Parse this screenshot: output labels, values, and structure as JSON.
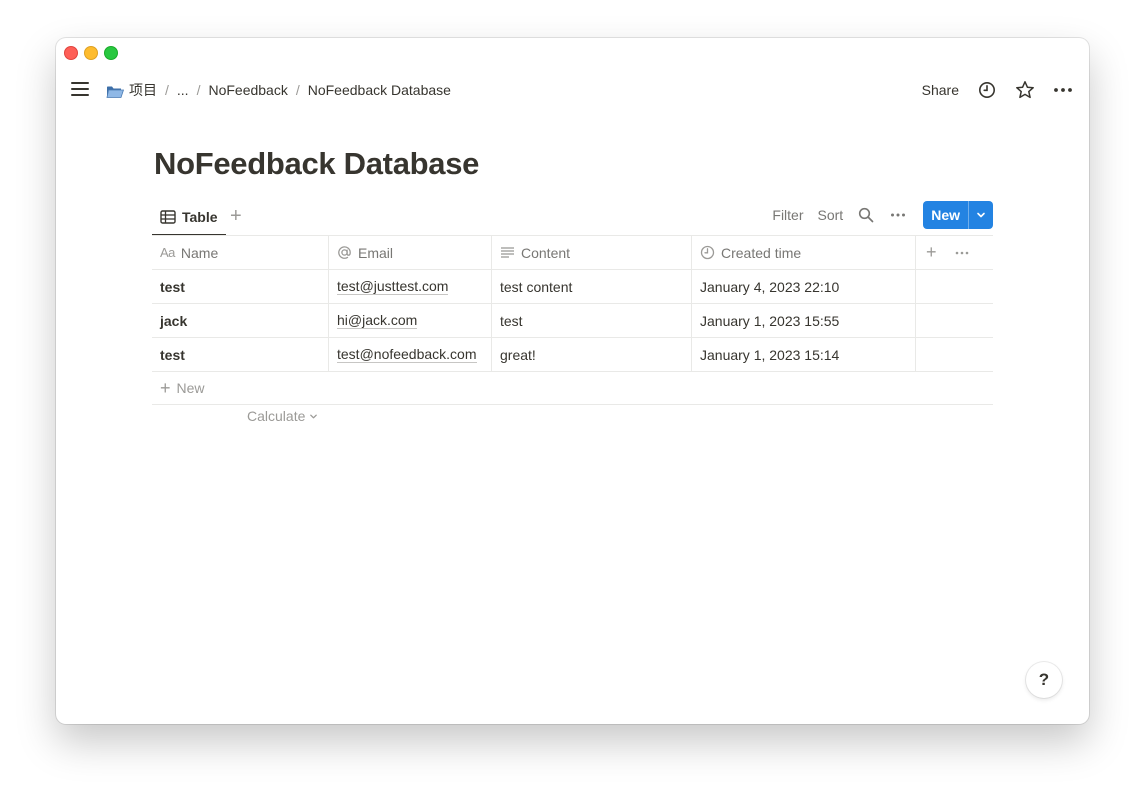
{
  "breadcrumb": {
    "workspace_icon": "folder-icon",
    "workspace": "项目",
    "ellipsis": "...",
    "parent": "NoFeedback",
    "current": "NoFeedback Database",
    "separator": "/"
  },
  "topbar": {
    "share_label": "Share"
  },
  "page": {
    "title": "NoFeedback Database"
  },
  "view": {
    "tab_label": "Table",
    "add_view": "+",
    "filter_label": "Filter",
    "sort_label": "Sort",
    "new_label": "New"
  },
  "table": {
    "columns": [
      {
        "prefix": "Aa",
        "label": "Name",
        "icon": "title-icon"
      },
      {
        "label": "Email",
        "icon": "at-icon"
      },
      {
        "label": "Content",
        "icon": "text-lines-icon"
      },
      {
        "label": "Created time",
        "icon": "clock-icon"
      }
    ],
    "add_column": "+",
    "rows": [
      {
        "name": "test",
        "email": "test@justtest.com",
        "content": "test content",
        "created": "January 4, 2023 22:10"
      },
      {
        "name": "jack",
        "email": "hi@jack.com",
        "content": "test",
        "created": "January 1, 2023 15:55"
      },
      {
        "name": "test",
        "email": "test@nofeedback.com",
        "content": "great!",
        "created": "January 1, 2023 15:14"
      }
    ],
    "new_row_plus": "+",
    "new_row_label": "New",
    "calculate_label": "Calculate"
  },
  "help": {
    "label": "?"
  },
  "colors": {
    "accent": "#2383e2",
    "text": "#37352f",
    "muted": "#787774",
    "border": "#e9e9e7"
  }
}
